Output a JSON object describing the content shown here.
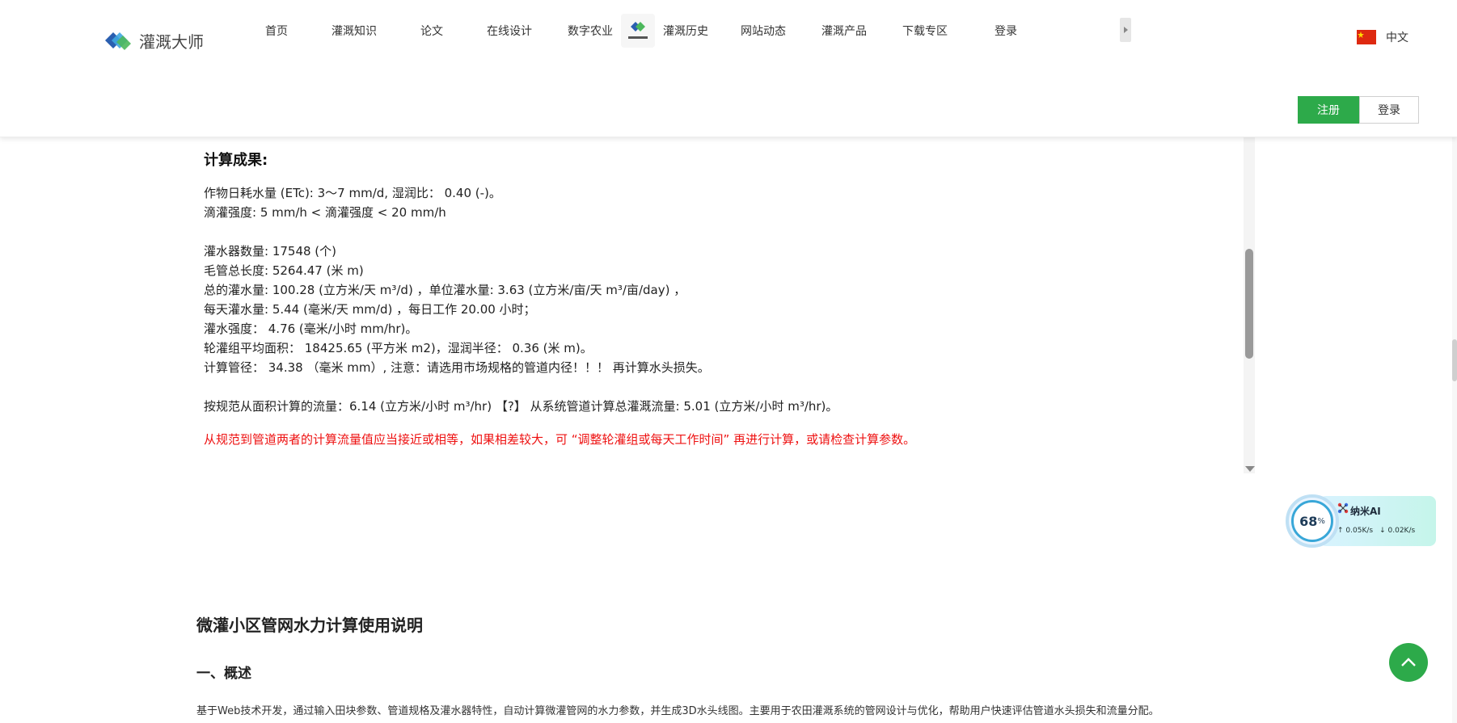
{
  "header": {
    "brand": "灌溉大师",
    "nav": [
      "首页",
      "灌溉知识",
      "论文",
      "在线设计",
      "数字农业",
      "灌溉历史",
      "网站动态",
      "灌溉产品",
      "下载专区",
      "登录"
    ],
    "language": "中文",
    "register_label": "注册",
    "login_label": "登录"
  },
  "results": {
    "title": "计算成果:",
    "lines": [
      "作物日耗水量 (ETc): 3～7 mm/d, 湿润比： 0.40 (-)。",
      "滴灌强度: 5 mm/h < 滴灌强度 < 20 mm/h",
      "灌水器数量: 17548 (个)",
      "毛管总长度: 5264.47 (米 m)",
      "总的灌水量: 100.28 (立方米/天 m³/d) ，单位灌水量: 3.63 (立方米/亩/天 m³/亩/day) ，",
      "每天灌水量: 5.44 (毫米/天 mm/d) ，每日工作 20.00 小时；",
      "灌水强度： 4.76 (毫米/小时 mm/hr)。",
      "轮灌组平均面积： 18425.65 (平方米 m2)，湿润半径： 0.36 (米 m)。",
      "计算管径： 34.38 （毫米 mm）, 注意：请选用市场规格的管道内径！！！ 再计算水头损失。",
      "按规范从面积计算的流量：6.14 (立方米/小时 m³/hr) 【?】 从系统管道计算总灌溉流量: 5.01 (立方米/小时 m³/hr)。"
    ],
    "warning": "从规范到管道两者的计算流量值应当接近或相等，如果相差较大，可 “调整轮灌组或每天工作时间” 再进行计算，或请检查计算参数。"
  },
  "doc": {
    "title": "微灌小区管网水力计算使用说明",
    "section_heading": "一、概述",
    "paragraph": "基于Web技术开发，通过输入田块参数、管道规格及灌水器特性，自动计算微灌管网的水力参数，并生成3D水头线图。主要用于农田灌溉系统的管网设计与优化，帮助用户快速评估管道水头损失和流量分配。"
  },
  "widget": {
    "percent": "68",
    "percent_unit": "%",
    "name": "纳米AI",
    "upload": "0.05K/s",
    "download": "0.02K/s"
  },
  "colors": {
    "accent_green": "#2daa4a",
    "warning_red": "#ee1111"
  },
  "icons": [
    "logo-icon",
    "nav-badge-icon",
    "chevron-right-icon",
    "china-flag-icon",
    "ai-icon",
    "arrow-up-icon",
    "arrow-down-icon",
    "chevron-up-icon"
  ]
}
